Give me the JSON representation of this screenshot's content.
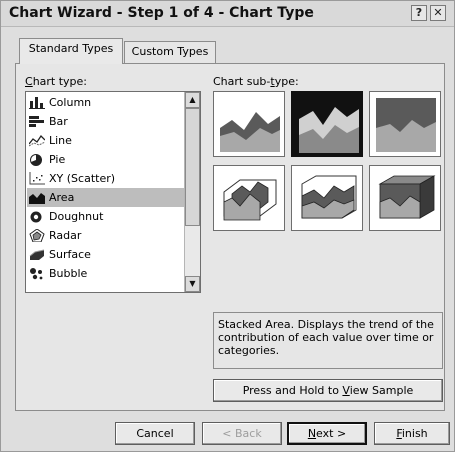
{
  "window": {
    "title": "Chart Wizard - Step 1 of 4 - Chart Type",
    "help_glyph": "?",
    "close_glyph": "✕"
  },
  "tabs": [
    {
      "label": "Standard Types",
      "active": true
    },
    {
      "label": "Custom Types",
      "active": false
    }
  ],
  "chart_type_label_first": "C",
  "chart_type_label_rest": "hart type:",
  "chart_subtype_label_pre": "Chart sub-",
  "chart_subtype_label_ul": "t",
  "chart_subtype_label_post": "ype:",
  "chart_types": [
    {
      "label": "Column",
      "icon": "column-chart-icon"
    },
    {
      "label": "Bar",
      "icon": "bar-chart-icon"
    },
    {
      "label": "Line",
      "icon": "line-chart-icon"
    },
    {
      "label": "Pie",
      "icon": "pie-chart-icon"
    },
    {
      "label": "XY (Scatter)",
      "icon": "scatter-chart-icon"
    },
    {
      "label": "Area",
      "icon": "area-chart-icon",
      "selected": true
    },
    {
      "label": "Doughnut",
      "icon": "doughnut-chart-icon"
    },
    {
      "label": "Radar",
      "icon": "radar-chart-icon"
    },
    {
      "label": "Surface",
      "icon": "surface-chart-icon"
    },
    {
      "label": "Bubble",
      "icon": "bubble-chart-icon"
    }
  ],
  "scrollbar": {
    "up_glyph": "▲",
    "down_glyph": "▼"
  },
  "subtypes": [
    {
      "name": "area",
      "selected": false
    },
    {
      "name": "stacked-area",
      "selected": true
    },
    {
      "name": "100-percent-stacked-area",
      "selected": false
    },
    {
      "name": "3d-area",
      "selected": false
    },
    {
      "name": "3d-stacked-area",
      "selected": false
    },
    {
      "name": "3d-100-percent-stacked-area",
      "selected": false
    }
  ],
  "description": "Stacked Area. Displays the trend of the contribution of each value over time or categories.",
  "sample_button": {
    "pre": "Press and Hold to ",
    "ul": "V",
    "post": "iew Sample"
  },
  "buttons": {
    "cancel": "Cancel",
    "back": "< Back",
    "next_ul": "N",
    "next_rest": "ext >",
    "finish_ul": "F",
    "finish_rest": "inish"
  },
  "colors": {
    "area_dark": "#5a5a5a",
    "area_mid": "#9a9a9a",
    "area_light": "#c8c8c8",
    "selection": "#bdbdbd"
  }
}
